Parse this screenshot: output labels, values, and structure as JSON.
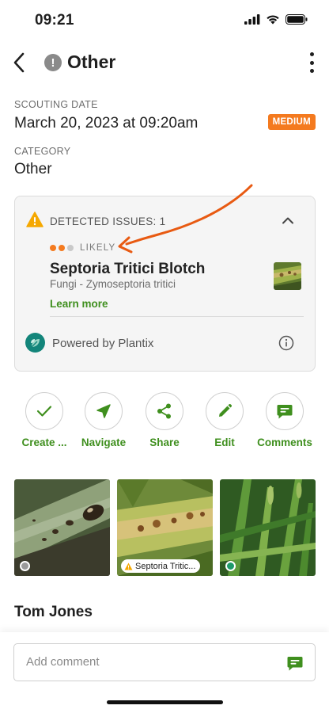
{
  "status_bar": {
    "time": "09:21"
  },
  "header": {
    "badge": "!",
    "title": "Other"
  },
  "scouting_date": {
    "label": "SCOUTING DATE",
    "value": "March 20, 2023 at 09:20am",
    "severity": "MEDIUM"
  },
  "category": {
    "label": "CATEGORY",
    "value": "Other"
  },
  "detected_issues": {
    "header": "DETECTED ISSUES: 1",
    "likelihood": "LIKELY",
    "likelihood_level": 2,
    "likelihood_max": 3,
    "issue_name": "Septoria Tritici Blotch",
    "issue_subtitle": "Fungi - Zymoseptoria tritici",
    "learn_more": "Learn more",
    "powered_by": "Powered by Plantix"
  },
  "actions": [
    {
      "label": "Create ...",
      "icon": "check-icon"
    },
    {
      "label": "Navigate",
      "icon": "navigate-icon"
    },
    {
      "label": "Share",
      "icon": "share-icon"
    },
    {
      "label": "Edit",
      "icon": "pencil-icon"
    },
    {
      "label": "Comments",
      "icon": "comment-icon"
    }
  ],
  "photos": [
    {
      "status": "none"
    },
    {
      "tag": "Septoria Tritic..."
    },
    {
      "status": "ok"
    }
  ],
  "author": "Tom Jones",
  "comment": {
    "placeholder": "Add comment"
  },
  "colors": {
    "accent_green": "#3f8f1e",
    "severity_orange": "#f47a1f",
    "annotation_arrow": "#e85a12",
    "plantix_teal": "#13857a"
  }
}
